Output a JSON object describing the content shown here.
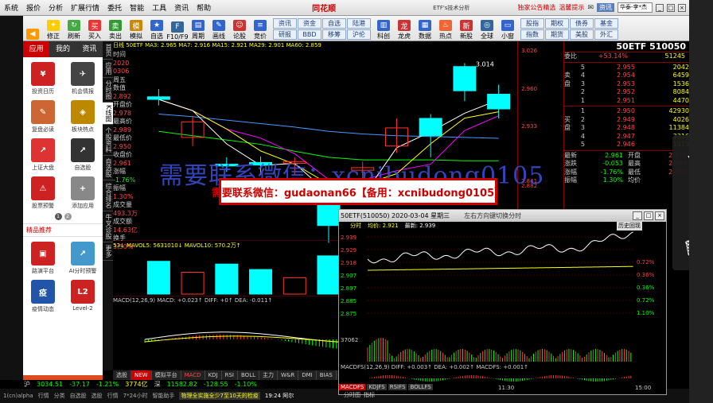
{
  "menubar": {
    "items": [
      "系统",
      "报价",
      "分析",
      "扩展行情",
      "委托",
      "智能",
      "工具",
      "资讯",
      "帮助"
    ],
    "brand": "同花顺",
    "app_title": "ETF's技术分析",
    "tag1": "独家公告精选",
    "tag2": "温馨提示",
    "search_btn": "资讯",
    "combo": "华泰-李*杰"
  },
  "toolbar": {
    "buttons": [
      "",
      "",
      "修正",
      "刷新",
      "买入",
      "卖出",
      "模拟",
      "自选",
      "F10/F9",
      "周期",
      "画线",
      "论股",
      "竞价"
    ],
    "grid": [
      [
        "资讯",
        "资金",
        "自选",
        "陆港"
      ],
      [
        "研报",
        "BBD",
        "移筹",
        "沪伦"
      ]
    ],
    "buttons2": [
      "科创",
      "龙虎",
      "数据",
      "热点",
      "新股",
      "全球",
      "小窗"
    ],
    "grid2": [
      [
        "股指",
        "期权",
        "债券",
        "基金"
      ],
      [
        "指数",
        "期货",
        "美股",
        "外汇"
      ]
    ]
  },
  "leftpanel": {
    "tabs": [
      "应用",
      "我的",
      "资讯"
    ],
    "apps": [
      "投资日历",
      "机会情报",
      "复盘必读",
      "板块热点",
      "上证大盘",
      "自选股",
      "股票预警",
      "添加应用"
    ],
    "page_dots": [
      "1",
      "2"
    ],
    "section": "精品推荐",
    "apps2": [
      "路演平台",
      "AI分时预警",
      "疫情动态",
      "Level-2"
    ],
    "free_btn": "免费用T+0"
  },
  "vtabs": [
    "首页",
    "应用",
    "分时图",
    "K线图",
    "个股资料",
    "自选股",
    "综合排名",
    "牛叉诊股",
    "更多"
  ],
  "chart": {
    "indicators": "日线 50ETF MA3: 2.965 MA7: 2.916 MA15: 2.921 MA29: 2.901 MA60: 2.859",
    "info": {
      "time_label": "时间",
      "date": "2020",
      "date2": "0306",
      "weekday": "周五",
      "value": "数值",
      "v1": "2.892",
      "open_l": "开盘价",
      "open": "2.978",
      "high_l": "最高价",
      "high": "2.989",
      "low_l": "最低价",
      "low": "2.950",
      "close_l": "收盘价",
      "close": "2.961",
      "chg_l": "涨幅",
      "chg": "-1.76%",
      "amp_l": "振幅",
      "amp": "1.30%",
      "vol_l": "成交量",
      "vol": "493.3万",
      "amt_l": "成交额",
      "amt": "14.63亿",
      "turn_l": "换手",
      "turn": "3.50%"
    },
    "yticks": [
      "3.026",
      "2.960",
      "2.933",
      "2.882",
      "2.841"
    ],
    "labels": {
      "hi": "3.014",
      "lo": "2.806"
    },
    "candles": [
      {
        "o": 2.975,
        "c": 2.972,
        "h": 2.984,
        "l": 2.965
      },
      {
        "o": 2.928,
        "c": 2.946,
        "h": 2.953,
        "l": 2.918
      },
      {
        "o": 2.897,
        "c": 2.895,
        "h": 2.905,
        "l": 2.888
      },
      {
        "o": 2.899,
        "c": 2.896,
        "h": 2.906,
        "l": 2.885
      },
      {
        "o": 2.898,
        "c": 2.9,
        "h": 2.905,
        "l": 2.885
      },
      {
        "o": 2.853,
        "c": 2.826,
        "h": 2.86,
        "l": 2.806
      },
      {
        "o": 2.89,
        "c": 2.893,
        "h": 2.9,
        "l": 2.85
      },
      {
        "o": 2.918,
        "c": 2.939,
        "h": 2.95,
        "l": 2.91
      },
      {
        "o": 2.95,
        "c": 2.93,
        "h": 2.955,
        "l": 2.905
      },
      {
        "o": 3.01,
        "c": 2.982,
        "h": 3.014,
        "l": 2.97
      },
      {
        "o": 2.978,
        "c": 2.961,
        "h": 2.989,
        "l": 2.95
      }
    ],
    "vol_label": "53↓ MAVOL5: 5631010↓ MAVOL10: 570.2万↑",
    "vols": [
      60,
      40,
      55,
      45,
      30,
      70,
      50,
      75,
      55,
      80,
      50
    ],
    "macd_label": "MACD(12,26,9) MACD: +0.023↑ DIFF: +0↑ DEA: -0.011↑"
  },
  "quote": {
    "title": "50ETF 510050",
    "wb_label": "委比",
    "wb": "+53.14%",
    "wb_vol": "51245",
    "sell": [
      [
        "5",
        "2.955",
        "2042"
      ],
      [
        "4",
        "2.954",
        "6459"
      ],
      [
        "3",
        "2.953",
        "1536"
      ],
      [
        "2",
        "2.952",
        "8084"
      ],
      [
        "1",
        "2.951",
        "4470"
      ]
    ],
    "buy": [
      [
        "1",
        "2.950",
        "42930"
      ],
      [
        "2",
        "2.949",
        "4026"
      ],
      [
        "3",
        "2.948",
        "11384"
      ],
      [
        "4",
        "2.947",
        "3316"
      ],
      [
        "5",
        "2.946",
        "1313"
      ]
    ],
    "side_sell": "卖盘",
    "side_buy": "买盘",
    "stats": [
      [
        "最新",
        "2.961",
        "开盘",
        "2.978"
      ],
      [
        "涨跌",
        "-0.053",
        "最高",
        "2.989"
      ],
      [
        "涨幅",
        "-1.76%",
        "最低",
        "2.950"
      ],
      [
        "振幅",
        "1.30%",
        "均价",
        ""
      ]
    ]
  },
  "popup": {
    "title": "50ETF(510050) 2020-03-04 星期三",
    "hint": "左右方向键切换分时",
    "sub": [
      "分时",
      "均价: 2.921",
      "最新: 2.939"
    ],
    "history_btn": "历史回现",
    "yticks": [
      "2.939",
      "2.929",
      "2.918",
      "2.907",
      "2.897",
      "2.885",
      "2.875"
    ],
    "pct": [
      "0.72%",
      "0.36%",
      "0.36%",
      "0.72%",
      "1.10%"
    ],
    "vol_tick": "37062",
    "macd": "MACDFS(12,26,9) DIFF: +0.003↑ DEA: +0.002↑ MACDFS: +0.001↑",
    "times": [
      "09:30",
      "11:30",
      "15:00"
    ],
    "tabs": [
      "MACDFS",
      "KDJFS",
      "RSIFS",
      "BOLLFS"
    ],
    "bottom": [
      "分时图",
      "指标"
    ]
  },
  "banner": "需要联系微信：gudaonan66【备用：xcnibudong0105】",
  "watermark": "需要联系微信：xcnibudong0105",
  "bottom_tabs": [
    "选股",
    "NEW",
    "模拟平台",
    "MACD",
    "KDJ",
    "RSI",
    "BOLL",
    "主力",
    "W&R",
    "DMI",
    "BIAS"
  ],
  "status1": [
    "沪",
    "3034.51",
    "-37.17",
    "-1.21%",
    "3774亿",
    "深",
    "11582.82",
    "-128.55",
    "-1.10%"
  ],
  "status2": [
    "1(cn)alpha",
    "行情",
    "分类",
    "自选股",
    "选股",
    "行情",
    "7*24小时",
    "智能助手",
    "物理全实施全少7至10天的检疫",
    "19:24 阿尔"
  ],
  "overlay": [
    "share",
    "download",
    "delete"
  ],
  "colors": {
    "up": "#ff3333",
    "down": "#00ffff",
    "ma3": "#ffffff",
    "ma7": "#ffff00",
    "ma15": "#ff00ff",
    "ma29": "#00ff00",
    "ma60": "#4499ff"
  }
}
